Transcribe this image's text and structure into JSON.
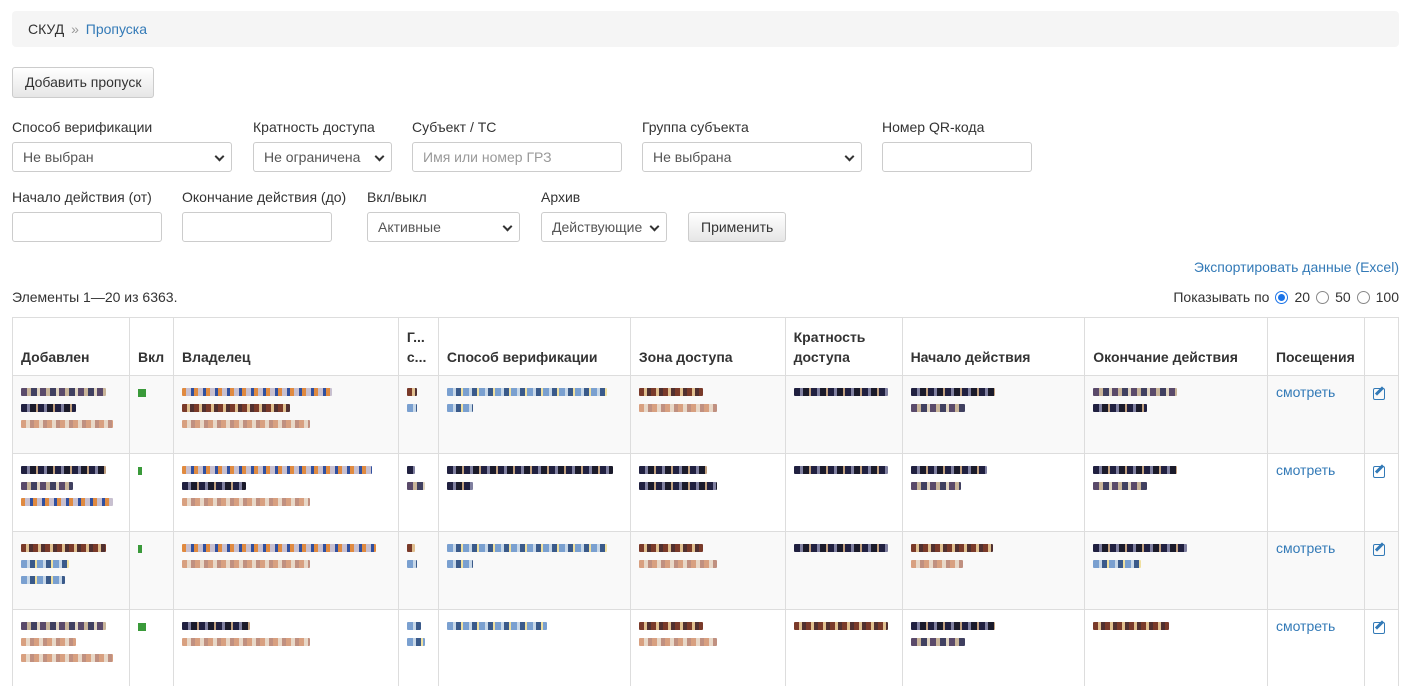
{
  "breadcrumb": {
    "root": "СКУД",
    "sep": "»",
    "current": "Пропуска"
  },
  "add_button": "Добавить пропуск",
  "filters": {
    "verification_label": "Способ верификации",
    "verification_value": "Не выбран",
    "multiplicity_label": "Кратность доступа",
    "multiplicity_value": "Не ограничена",
    "subject_label": "Субъект / ТС",
    "subject_placeholder": "Имя или номер ГРЗ",
    "group_label": "Группа субъекта",
    "group_value": "Не выбрана",
    "qr_label": "Номер QR-кода",
    "qr_value": "",
    "start_label": "Начало действия (от)",
    "end_label": "Окончание действия (до)",
    "onoff_label": "Вкл/выкл",
    "onoff_value": "Активные",
    "archive_label": "Архив",
    "archive_value": "Действующие",
    "apply_button": "Применить"
  },
  "export_link": "Экспортировать данные (Excel)",
  "summary": "Элементы 1—20 из 6363.",
  "perpage": {
    "label": "Показывать по",
    "options": [
      "20",
      "50",
      "100"
    ],
    "selected": "20"
  },
  "table": {
    "headers": [
      "Добавлен",
      "Вкл",
      "Владелец",
      "Г... с...",
      "Способ верификации",
      "Зона доступа",
      "Кратность доступа",
      "Начало действия",
      "Окончание действия",
      "Посещения",
      ""
    ],
    "visits_link": "смотреть"
  }
}
